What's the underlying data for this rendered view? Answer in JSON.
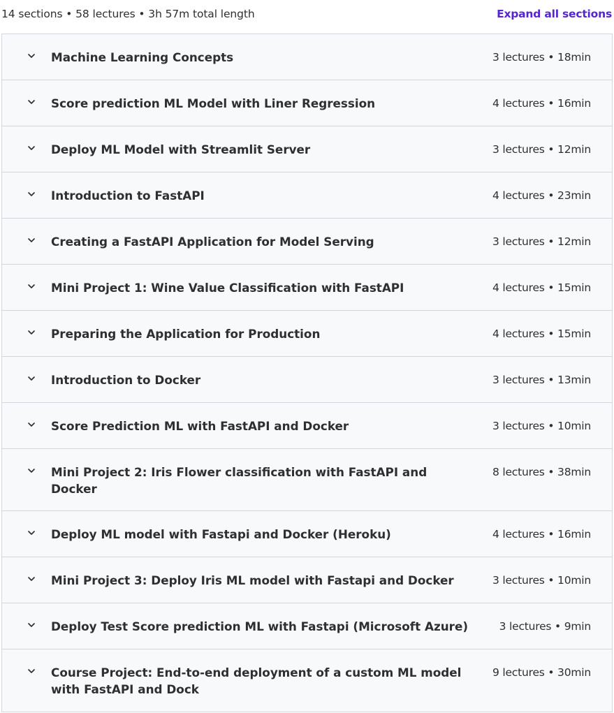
{
  "summary": {
    "text": "14 sections • 58 lectures • 3h 57m total length",
    "expand_label": "Expand all sections"
  },
  "colors": {
    "accent": "#5624d0",
    "text": "#2d2f31",
    "row_bg": "#f7f9fa",
    "border": "#d1d7dc"
  },
  "icons": {
    "section_toggle": "chevron-down-icon"
  },
  "sections": [
    {
      "title": "Machine Learning Concepts",
      "meta": "3 lectures • 18min"
    },
    {
      "title": "Score prediction ML Model with Liner Regression",
      "meta": "4 lectures • 16min"
    },
    {
      "title": "Deploy ML Model with Streamlit Server",
      "meta": "3 lectures • 12min"
    },
    {
      "title": "Introduction to FastAPI",
      "meta": "4 lectures • 23min"
    },
    {
      "title": "Creating a FastAPI Application for Model Serving",
      "meta": "3 lectures • 12min"
    },
    {
      "title": "Mini Project 1: Wine Value Classification with FastAPI",
      "meta": "4 lectures • 15min"
    },
    {
      "title": "Preparing the Application for Production",
      "meta": "4 lectures • 15min"
    },
    {
      "title": "Introduction to Docker",
      "meta": "3 lectures • 13min"
    },
    {
      "title": "Score Prediction ML with FastAPI and Docker",
      "meta": "3 lectures • 10min"
    },
    {
      "title": "Mini Project 2: Iris Flower classification with FastAPI and Docker",
      "meta": "8 lectures • 38min"
    },
    {
      "title": "Deploy ML model with Fastapi and Docker (Heroku)",
      "meta": "4 lectures • 16min"
    },
    {
      "title": "Mini Project 3: Deploy Iris ML model with Fastapi and Docker",
      "meta": "3 lectures • 10min"
    },
    {
      "title": "Deploy Test Score prediction ML with Fastapi (Microsoft Azure)",
      "meta": "3 lectures • 9min"
    },
    {
      "title": "Course Project: End-to-end deployment of a custom ML model with FastAPI and Dock",
      "meta": "9 lectures • 30min"
    }
  ]
}
